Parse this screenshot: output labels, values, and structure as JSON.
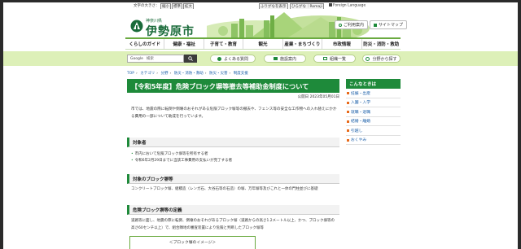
{
  "utility": {
    "font_size_label": "文字の大きさ：",
    "font_small": "縮小",
    "font_standard": "標準",
    "font_large": "拡大",
    "furigana": "ふりがなを表示",
    "romaji": "ひらがな｜Romaji",
    "language": "Foreign Language"
  },
  "header": {
    "logo_sub": "神奈川県",
    "logo_title": "伊勢原市",
    "contact_label": "ご利用案内",
    "sitemap_label": "サイトマップ"
  },
  "gnav": [
    {
      "label": "くらしのガイド"
    },
    {
      "label": "健康・福祉"
    },
    {
      "label": "子育て・教育"
    },
    {
      "label": "観光"
    },
    {
      "label": "産業・まちづくり"
    },
    {
      "label": "市政情報"
    },
    {
      "label": "防災・消防・救助"
    }
  ],
  "search": {
    "google_label": "Google",
    "placeholder": "検索",
    "faq_label": "よくある質問",
    "event_label": "施設案内",
    "org_label": "組織一覧",
    "find_label": "分野から探す"
  },
  "breadcrumb": [
    "TOP",
    "カテゴリ",
    "分野",
    "防災・消防・救助",
    "防災・災害",
    "制度支援"
  ],
  "page": {
    "title": "【令和5年度】危険ブロック塀等撤去等補助金制度について",
    "pubdate": "公開日 2023年05月01日",
    "lead": "市では、地震の際に転倒や倒壊のおそれがある危険ブロック塀等の撤去や、フェンス等の安全な工作物への入れ替えにかかる費用の一部について助成を行っています。",
    "sec1_title": "対象者",
    "sec1_items": [
      "市内において危険ブロック塀等を所有する者",
      "令和6年2月29日までに当該工事費用の支払いが完了する者"
    ],
    "sec2_title": "対象のブロック塀等",
    "sec2_text": "コンクリートブロック塀、組積造（レンガ石、大谷石等の石造）の塀、万年塀等及びこれと一体の門柱並びに基礎",
    "sec3_title": "危険ブロック塀等の定義",
    "sec3_text": "道路等に面し、地震の際に転倒、倒壊のおそれがあるブロック塀（道路からの高さ1.2メートル以上、かつ、ブロック塀等の高さ60センチ以上）で、組合隣地の審査装置により危険と判断したブロック塀等",
    "fig_caption": "＜ブロック塀のイメージ＞"
  },
  "sidebar": {
    "title": "こんなときは",
    "items": [
      {
        "label": "妊娠・出産"
      },
      {
        "label": "入園・入学"
      },
      {
        "label": "就職・退職"
      },
      {
        "label": "結婚・離婚"
      },
      {
        "label": "引越し"
      },
      {
        "label": "おくやみ"
      }
    ]
  },
  "colors": {
    "brand_green": "#1e8a3a",
    "band_green": "#ddf0b8",
    "link_blue": "#1a5ea8"
  }
}
